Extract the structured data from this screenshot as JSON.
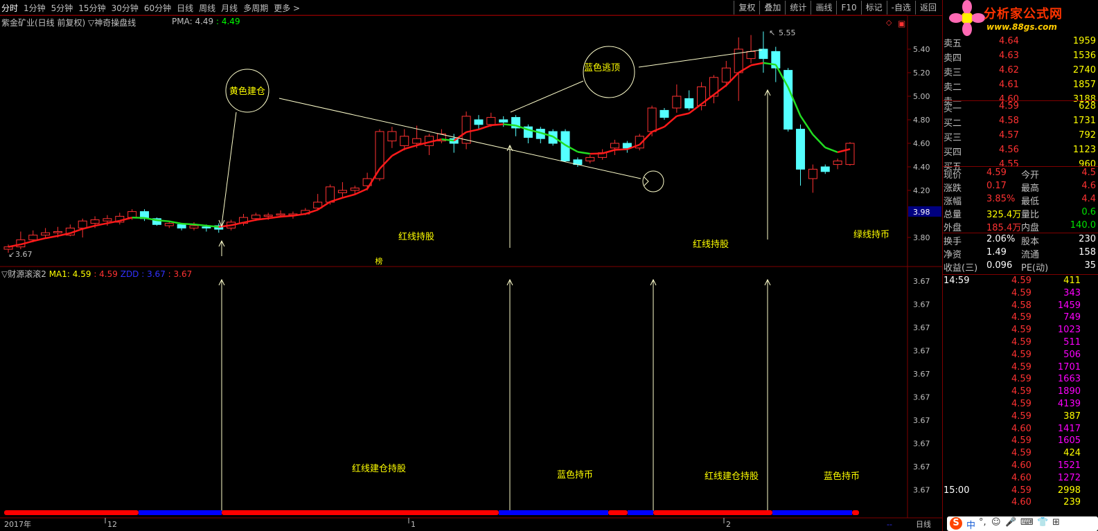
{
  "toolbar": {
    "periods": [
      "分时",
      "1分钟",
      "5分钟",
      "15分钟",
      "30分钟",
      "60分钟",
      "日线",
      "周线",
      "月线",
      "多周期",
      "更多 >"
    ],
    "tools": [
      "复权",
      "叠加",
      "统计",
      "画线",
      "F10",
      "标记",
      "-自选",
      "返回"
    ]
  },
  "chart": {
    "title": "紫金矿业(日线 前复权) ▽神奇操盘线",
    "pma_label": "PMA: 4.49",
    "pma_value": ": 4.49",
    "high_mark": "5.55",
    "low_mark": "3.67",
    "bang": "榜",
    "price_tag": "3.98",
    "y_ticks": [
      "5.40",
      "5.20",
      "5.00",
      "4.80",
      "4.60",
      "4.40",
      "4.20",
      "3.80"
    ],
    "annotations": {
      "yellow_entry": "黄色建仓",
      "blue_escape": "蓝色逃顶",
      "red_hold_1": "红线持股",
      "red_hold_2": "红线持股",
      "green_hold": "绿线持币"
    }
  },
  "sub_chart": {
    "title": "▽财源滚滚2",
    "ma1_label": "MA1: 4.59",
    "val1": ": 4.59",
    "zdd_label": "ZDD",
    "val2": ": 3.67",
    "val3": ": 3.67",
    "y_ticks": [
      "3.67",
      "3.67",
      "3.67",
      "3.67",
      "3.67",
      "3.67",
      "3.67",
      "3.67",
      "3.67",
      "3.67"
    ],
    "annotations": {
      "red_build_1": "红线建仓持股",
      "blue_hold_1": "蓝色持币",
      "red_build_2": "红线建仓持股",
      "blue_hold_2": "蓝色持币"
    }
  },
  "bottom": {
    "year": "2017年",
    "m12": "12",
    "m1": "1",
    "m2": "2",
    "period": "日线"
  },
  "logo": {
    "text": "分析家公式网",
    "url": "www.88gs.com"
  },
  "quotes": {
    "sell": [
      {
        "label": "卖五",
        "price": "4.64",
        "vol": "1959"
      },
      {
        "label": "卖四",
        "price": "4.63",
        "vol": "1536"
      },
      {
        "label": "卖三",
        "price": "4.62",
        "vol": "2740"
      },
      {
        "label": "卖二",
        "price": "4.61",
        "vol": "1857"
      },
      {
        "label": "卖一",
        "price": "4.60",
        "vol": "3188"
      }
    ],
    "buy": [
      {
        "label": "买一",
        "price": "4.59",
        "vol": "628"
      },
      {
        "label": "买二",
        "price": "4.58",
        "vol": "1731"
      },
      {
        "label": "买三",
        "price": "4.57",
        "vol": "792"
      },
      {
        "label": "买四",
        "price": "4.56",
        "vol": "1123"
      },
      {
        "label": "买五",
        "price": "4.55",
        "vol": "960"
      }
    ],
    "stats": [
      {
        "l1": "现价",
        "v1": "4.59",
        "l2": "今开",
        "v2": "4.5"
      },
      {
        "l1": "涨跌",
        "v1": "0.17",
        "l2": "最高",
        "v2": "4.6"
      },
      {
        "l1": "涨幅",
        "v1": "3.85%",
        "l2": "最低",
        "v2": "4.4"
      },
      {
        "l1": "总量",
        "v1": "325.4万",
        "l2": "量比",
        "v2": "0.6"
      },
      {
        "l1": "外盘",
        "v1": "185.4万",
        "l2": "内盘",
        "v2": "140.0"
      }
    ],
    "fund": [
      {
        "l1": "换手",
        "v1": "2.06%",
        "l2": "股本",
        "v2": "230"
      },
      {
        "l1": "净资",
        "v1": "1.49",
        "l2": "流通",
        "v2": "158"
      },
      {
        "l1": "收益(三)",
        "v1": "0.096",
        "l2": "PE(动)",
        "v2": "35"
      }
    ],
    "ticks": [
      {
        "time": "14:59",
        "price": "4.59",
        "vol": "411",
        "vc": "yel"
      },
      {
        "time": "",
        "price": "4.59",
        "vol": "343",
        "vc": "mag"
      },
      {
        "time": "",
        "price": "4.58",
        "vol": "1459",
        "vc": "mag"
      },
      {
        "time": "",
        "price": "4.59",
        "vol": "749",
        "vc": "mag"
      },
      {
        "time": "",
        "price": "4.59",
        "vol": "1023",
        "vc": "mag"
      },
      {
        "time": "",
        "price": "4.59",
        "vol": "511",
        "vc": "mag"
      },
      {
        "time": "",
        "price": "4.59",
        "vol": "506",
        "vc": "mag"
      },
      {
        "time": "",
        "price": "4.59",
        "vol": "1701",
        "vc": "mag"
      },
      {
        "time": "",
        "price": "4.59",
        "vol": "1663",
        "vc": "mag"
      },
      {
        "time": "",
        "price": "4.59",
        "vol": "1890",
        "vc": "mag"
      },
      {
        "time": "",
        "price": "4.59",
        "vol": "4139",
        "vc": "mag"
      },
      {
        "time": "",
        "price": "4.59",
        "vol": "387",
        "vc": "yel"
      },
      {
        "time": "",
        "price": "4.60",
        "vol": "1417",
        "vc": "mag"
      },
      {
        "time": "",
        "price": "4.59",
        "vol": "1605",
        "vc": "mag"
      },
      {
        "time": "",
        "price": "4.59",
        "vol": "424",
        "vc": "yel"
      },
      {
        "time": "",
        "price": "4.60",
        "vol": "1521",
        "vc": "mag"
      },
      {
        "time": "",
        "price": "4.60",
        "vol": "1272",
        "vc": "mag"
      },
      {
        "time": "15:00",
        "price": "4.59",
        "vol": "2998",
        "vc": "yel"
      },
      {
        "time": "",
        "price": "4.60",
        "vol": "239",
        "vc": "yel"
      }
    ]
  },
  "tray": {
    "ime": "中",
    "punct": "°,"
  },
  "chart_data": {
    "type": "candlestick",
    "title": "紫金矿业(日线 前复权)",
    "ylim": [
      3.62,
      5.6
    ],
    "candles": [
      [
        3.7,
        3.72,
        3.67,
        3.74
      ],
      [
        3.72,
        3.78,
        3.7,
        3.85
      ],
      [
        3.78,
        3.82,
        3.76,
        3.86
      ],
      [
        3.82,
        3.84,
        3.79,
        3.88
      ],
      [
        3.84,
        3.85,
        3.8,
        3.89
      ],
      [
        3.82,
        3.88,
        3.81,
        3.91
      ],
      [
        3.88,
        3.94,
        3.8,
        3.96
      ],
      [
        3.92,
        3.95,
        3.88,
        3.98
      ],
      [
        3.94,
        3.96,
        3.9,
        3.99
      ],
      [
        3.93,
        3.98,
        3.91,
        4.01
      ],
      [
        3.97,
        4.02,
        3.95,
        4.04
      ],
      [
        4.02,
        3.96,
        3.94,
        4.04
      ],
      [
        3.96,
        3.91,
        3.9,
        3.97
      ],
      [
        3.9,
        3.92,
        3.88,
        3.94
      ],
      [
        3.91,
        3.88,
        3.86,
        3.92
      ],
      [
        3.88,
        3.9,
        3.86,
        3.93
      ],
      [
        3.89,
        3.88,
        3.85,
        3.91
      ],
      [
        3.9,
        3.87,
        3.84,
        3.92
      ],
      [
        3.88,
        3.93,
        3.86,
        3.95
      ],
      [
        3.92,
        3.97,
        3.9,
        4.0
      ],
      [
        3.96,
        3.99,
        3.94,
        4.01
      ],
      [
        3.98,
        3.99,
        3.95,
        4.01
      ],
      [
        3.99,
        4.0,
        3.97,
        4.03
      ],
      [
        3.99,
        4.0,
        3.96,
        4.02
      ],
      [
        4.0,
        4.03,
        3.99,
        4.05
      ],
      [
        4.05,
        4.1,
        4.03,
        4.17
      ],
      [
        4.1,
        4.23,
        4.08,
        4.25
      ],
      [
        4.18,
        4.2,
        4.14,
        4.27
      ],
      [
        4.2,
        4.22,
        4.16,
        4.24
      ],
      [
        4.24,
        4.3,
        4.2,
        4.35
      ],
      [
        4.3,
        4.7,
        4.28,
        4.72
      ],
      [
        4.62,
        4.7,
        4.56,
        4.74
      ],
      [
        4.58,
        4.66,
        4.54,
        4.72
      ],
      [
        4.6,
        4.64,
        4.56,
        4.75
      ],
      [
        4.58,
        4.66,
        4.5,
        4.68
      ],
      [
        4.62,
        4.68,
        4.6,
        4.72
      ],
      [
        4.64,
        4.6,
        4.52,
        4.68
      ],
      [
        4.6,
        4.83,
        4.55,
        4.87
      ],
      [
        4.8,
        4.76,
        4.72,
        4.84
      ],
      [
        4.76,
        4.82,
        4.74,
        4.86
      ],
      [
        4.8,
        4.78,
        4.74,
        4.83
      ],
      [
        4.82,
        4.73,
        4.66,
        4.84
      ],
      [
        4.74,
        4.65,
        4.6,
        4.76
      ],
      [
        4.72,
        4.64,
        4.6,
        4.74
      ],
      [
        4.7,
        4.6,
        4.58,
        4.72
      ],
      [
        4.7,
        4.45,
        4.44,
        4.72
      ],
      [
        4.46,
        4.42,
        4.4,
        4.48
      ],
      [
        4.45,
        4.48,
        4.43,
        4.5
      ],
      [
        4.48,
        4.52,
        4.46,
        4.55
      ],
      [
        4.56,
        4.6,
        4.5,
        4.63
      ],
      [
        4.6,
        4.56,
        4.52,
        4.62
      ],
      [
        4.56,
        4.66,
        4.54,
        4.68
      ],
      [
        4.7,
        4.9,
        4.66,
        4.92
      ],
      [
        4.88,
        4.82,
        4.8,
        4.9
      ],
      [
        4.9,
        5.0,
        4.86,
        5.1
      ],
      [
        4.98,
        4.9,
        4.88,
        5.05
      ],
      [
        4.92,
        5.08,
        4.88,
        5.12
      ],
      [
        5.0,
        5.16,
        4.94,
        5.18
      ],
      [
        5.12,
        5.24,
        5.08,
        5.3
      ],
      [
        5.2,
        5.4,
        4.96,
        5.5
      ],
      [
        5.32,
        5.38,
        5.28,
        5.52
      ],
      [
        5.4,
        5.32,
        5.2,
        5.55
      ],
      [
        5.38,
        5.24,
        5.12,
        5.42
      ],
      [
        5.22,
        4.72,
        4.7,
        5.24
      ],
      [
        4.72,
        4.38,
        4.24,
        4.76
      ],
      [
        4.3,
        4.38,
        4.18,
        4.42
      ],
      [
        4.4,
        4.36,
        4.34,
        4.42
      ],
      [
        4.42,
        4.45,
        4.38,
        4.47
      ],
      [
        4.42,
        4.6,
        4.41,
        4.61
      ]
    ]
  }
}
